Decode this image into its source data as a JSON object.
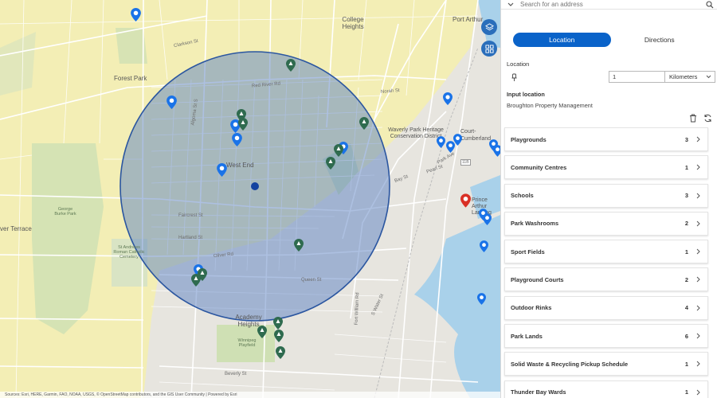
{
  "search": {
    "placeholder": "Search for an address"
  },
  "tabs": {
    "location": "Location",
    "directions": "Directions"
  },
  "location_label": "Location",
  "distance": {
    "value": "1",
    "unit": "Kilometers"
  },
  "input_location": {
    "label": "Input location",
    "value": "Broughton Property Management"
  },
  "results": [
    {
      "name": "Playgrounds",
      "count": "3"
    },
    {
      "name": "Community Centres",
      "count": "1"
    },
    {
      "name": "Schools",
      "count": "3"
    },
    {
      "name": "Park Washrooms",
      "count": "2"
    },
    {
      "name": "Sport Fields",
      "count": "1"
    },
    {
      "name": "Playground Courts",
      "count": "2"
    },
    {
      "name": "Outdoor Rinks",
      "count": "4"
    },
    {
      "name": "Park Lands",
      "count": "6"
    },
    {
      "name": "Solid Waste & Recycling Pickup Schedule",
      "count": "1"
    },
    {
      "name": "Thunder Bay Wards",
      "count": "1"
    }
  ],
  "map": {
    "labels": {
      "forest_park": "Forest Park",
      "college_heights": "College Heights",
      "port_arthur": "Port Arthur",
      "west_end": "West End",
      "waverly": "Waverly Park Heritage Conservation District",
      "court_cumberland": "Court- Cumberland",
      "prince_arthur": "Prince Arthur Landing",
      "academy_heights": "Academy Heights",
      "george_burke": "George Burke Park",
      "st_andrews": "St Andrews Roman Catholic Cemetery",
      "winnipeg_playfield": "Winnipeg Playfield",
      "ver_terrace": "ver Terrace",
      "hwy": "11B",
      "clarkson_st": "Clarkson St",
      "red_river_rd": "Red River Rd",
      "bay_st": "Bay St",
      "pearl_st": "Pearl St",
      "park_ave": "Park Ave",
      "fort_william_rd": "Fort William Rd",
      "oliver_rd": "Oliver Rd",
      "queen_st": "Queen St",
      "hartland_st": "Hartland St",
      "faircrest_st": "Faircrest St",
      "beverly_st": "Beverly St",
      "water_st": "S Water St",
      "norah_st": "Norah St",
      "algoma_st": "Algoma St S"
    },
    "attribution": "Sources: Esri, HERE, Garmin, FAO, NOAA, USGS, © OpenStreetMap contributors, and the GIS User Community | Powered by Esri",
    "colors": {
      "buffer_fill": "#5b82c4",
      "buffer_stroke": "#2b56a0",
      "ward_fill": "#f3eeb5",
      "water": "#a9d1ea",
      "park": "#cfe0b4",
      "pin_blue": "#1a73e8",
      "pin_green": "#2f6b4f",
      "pin_red": "#d93025"
    }
  }
}
